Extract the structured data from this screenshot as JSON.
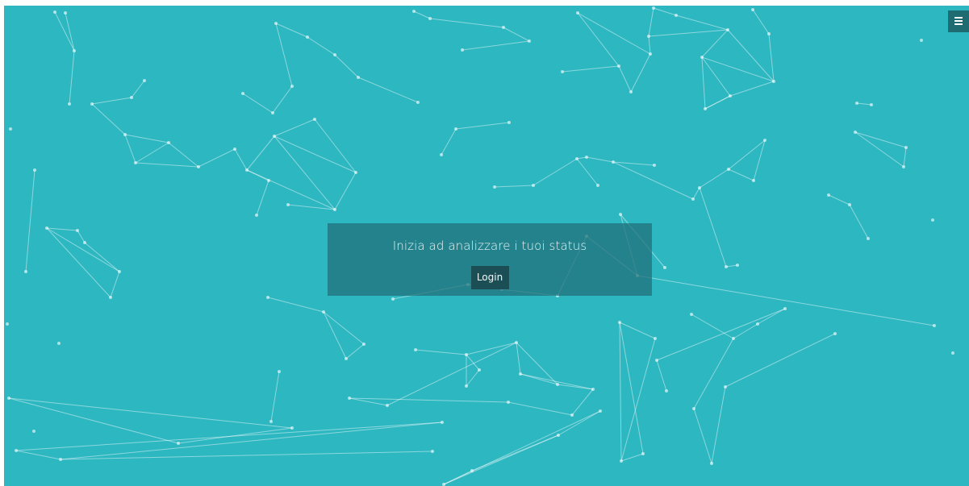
{
  "hero": {
    "title": "Inizia ad analizzare i tuoi status",
    "login_label": "Login"
  },
  "menu": {
    "icon": "hamburger-icon"
  },
  "colors": {
    "background": "#2db7c1",
    "panel": "#206e76",
    "button": "#1c4f55",
    "menu_button": "#1f6b72"
  }
}
